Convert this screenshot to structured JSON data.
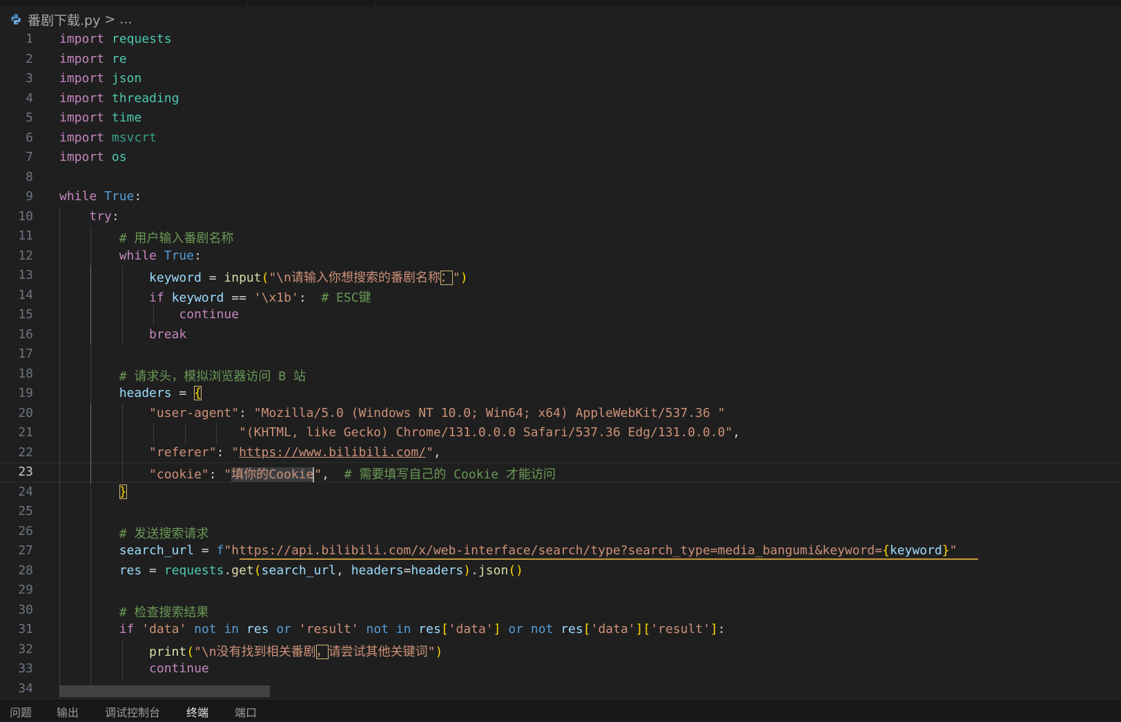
{
  "breadcrumb": {
    "file": "番剧下载.py",
    "separator": ">",
    "more": "..."
  },
  "editor": {
    "current_line": 23,
    "lines": [
      {
        "n": "1",
        "t": [
          [
            "import",
            "kw"
          ],
          [
            " ",
            ""
          ],
          [
            "requests",
            "md"
          ]
        ]
      },
      {
        "n": "2",
        "t": [
          [
            "import",
            "kw"
          ],
          [
            " ",
            ""
          ],
          [
            "re",
            "md"
          ]
        ]
      },
      {
        "n": "3",
        "t": [
          [
            "import",
            "kw"
          ],
          [
            " ",
            ""
          ],
          [
            "json",
            "md"
          ]
        ]
      },
      {
        "n": "4",
        "t": [
          [
            "import",
            "kw"
          ],
          [
            " ",
            ""
          ],
          [
            "threading",
            "md"
          ]
        ]
      },
      {
        "n": "5",
        "t": [
          [
            "import",
            "kw"
          ],
          [
            " ",
            ""
          ],
          [
            "time",
            "md"
          ]
        ]
      },
      {
        "n": "6",
        "t": [
          [
            "import",
            "kw"
          ],
          [
            " ",
            ""
          ],
          [
            "msvcrt",
            "md-dim"
          ]
        ]
      },
      {
        "n": "7",
        "t": [
          [
            "import",
            "kw"
          ],
          [
            " ",
            ""
          ],
          [
            "os",
            "md"
          ]
        ]
      },
      {
        "n": "8",
        "t": []
      },
      {
        "n": "9",
        "t": [
          [
            "while",
            "kw"
          ],
          [
            " ",
            ""
          ],
          [
            "True",
            "bi"
          ],
          [
            ":",
            "op"
          ]
        ]
      },
      {
        "n": "10",
        "t": [
          [
            "    ",
            ""
          ],
          [
            "try",
            "kw"
          ],
          [
            ":",
            "op"
          ]
        ]
      },
      {
        "n": "11",
        "t": [
          [
            "        ",
            ""
          ],
          [
            "# 用户输入番剧名称",
            "com"
          ]
        ]
      },
      {
        "n": "12",
        "t": [
          [
            "        ",
            ""
          ],
          [
            "while",
            "kw"
          ],
          [
            " ",
            ""
          ],
          [
            "True",
            "bi"
          ],
          [
            ":",
            "op"
          ]
        ]
      },
      {
        "n": "13",
        "t": [
          [
            "            ",
            ""
          ],
          [
            "keyword",
            "var"
          ],
          [
            " = ",
            "op"
          ],
          [
            "input",
            "fn"
          ],
          [
            "(",
            "yb"
          ],
          [
            "\"\\n请输入你想搜索的番剧名称",
            "str"
          ],
          [
            "：",
            "str box"
          ],
          [
            "\"",
            "str"
          ],
          [
            ")",
            "yb"
          ]
        ]
      },
      {
        "n": "14",
        "t": [
          [
            "            ",
            ""
          ],
          [
            "if",
            "kw"
          ],
          [
            " ",
            ""
          ],
          [
            "keyword",
            "var"
          ],
          [
            " == ",
            "op"
          ],
          [
            "'\\x1b'",
            "str"
          ],
          [
            ":  ",
            "op"
          ],
          [
            "# ESC键",
            "com"
          ]
        ]
      },
      {
        "n": "15",
        "t": [
          [
            "                ",
            ""
          ],
          [
            "continue",
            "kw"
          ]
        ]
      },
      {
        "n": "16",
        "t": [
          [
            "            ",
            ""
          ],
          [
            "break",
            "kw"
          ]
        ]
      },
      {
        "n": "17",
        "t": []
      },
      {
        "n": "18",
        "t": [
          [
            "        ",
            ""
          ],
          [
            "# 请求头，模拟浏览器访问 B 站",
            "com"
          ]
        ]
      },
      {
        "n": "19",
        "t": [
          [
            "        ",
            ""
          ],
          [
            "headers",
            "var"
          ],
          [
            " = ",
            "op"
          ],
          [
            "{",
            "yb box"
          ]
        ]
      },
      {
        "n": "20",
        "t": [
          [
            "            ",
            ""
          ],
          [
            "\"user-agent\"",
            "str"
          ],
          [
            ": ",
            "op"
          ],
          [
            "\"Mozilla/5.0 (Windows NT 10.0; Win64; x64) AppleWebKit/537.36 \"",
            "str"
          ]
        ]
      },
      {
        "n": "21",
        "t": [
          [
            "                        ",
            ""
          ],
          [
            "\"(KHTML, like Gecko) Chrome/131.0.0.0 Safari/537.36 Edg/131.0.0.0\"",
            "str"
          ],
          [
            ",",
            "op"
          ]
        ]
      },
      {
        "n": "22",
        "t": [
          [
            "            ",
            ""
          ],
          [
            "\"referer\"",
            "str"
          ],
          [
            ": ",
            "op"
          ],
          [
            "\"",
            "str"
          ],
          [
            "https://www.bilibili.com/",
            "str link"
          ],
          [
            "\"",
            "str"
          ],
          [
            ",",
            "op"
          ]
        ]
      },
      {
        "n": "23",
        "t": [
          [
            "            ",
            ""
          ],
          [
            "\"cookie\"",
            "str"
          ],
          [
            ": ",
            "op"
          ],
          [
            "\"",
            "str"
          ],
          [
            "填你的Cookie",
            "str sel"
          ],
          [
            "",
            "caret"
          ],
          [
            "\"",
            "str"
          ],
          [
            ",  ",
            "op"
          ],
          [
            "# 需要填写自己的 Cookie 才能访问",
            "com"
          ]
        ]
      },
      {
        "n": "24",
        "t": [
          [
            "        ",
            ""
          ],
          [
            "}",
            "yb box"
          ]
        ]
      },
      {
        "n": "25",
        "t": []
      },
      {
        "n": "26",
        "t": [
          [
            "        ",
            ""
          ],
          [
            "# 发送搜索请求",
            "com"
          ]
        ]
      },
      {
        "n": "27",
        "t": [
          [
            "        ",
            ""
          ],
          [
            "search_url",
            "var"
          ],
          [
            " = ",
            "op"
          ],
          [
            "f",
            "bi"
          ],
          [
            "\"",
            "str"
          ],
          [
            "https://api.bilibili.com/x/web-interface/search/type?search_type=media_bangumi&keyword=",
            "str"
          ],
          [
            "{",
            "yb"
          ],
          [
            "keyword",
            "var"
          ],
          [
            "}",
            "yb"
          ],
          [
            "\"",
            "str"
          ]
        ]
      },
      {
        "n": "28",
        "t": [
          [
            "        ",
            ""
          ],
          [
            "res",
            "var"
          ],
          [
            " = ",
            "op"
          ],
          [
            "requests",
            "md"
          ],
          [
            ".",
            "op"
          ],
          [
            "get",
            "fn"
          ],
          [
            "(",
            "yb"
          ],
          [
            "search_url",
            "var"
          ],
          [
            ", ",
            "op"
          ],
          [
            "headers",
            "var"
          ],
          [
            "=",
            "op"
          ],
          [
            "headers",
            "var"
          ],
          [
            ")",
            "yb"
          ],
          [
            ".",
            "op"
          ],
          [
            "json",
            "fn"
          ],
          [
            "()",
            "yb"
          ]
        ]
      },
      {
        "n": "29",
        "t": []
      },
      {
        "n": "30",
        "t": [
          [
            "        ",
            ""
          ],
          [
            "# 检查搜索结果",
            "com"
          ]
        ]
      },
      {
        "n": "31",
        "t": [
          [
            "        ",
            ""
          ],
          [
            "if",
            "kw"
          ],
          [
            " ",
            ""
          ],
          [
            "'data'",
            "str"
          ],
          [
            " ",
            ""
          ],
          [
            "not in",
            "bi"
          ],
          [
            " ",
            ""
          ],
          [
            "res",
            "var"
          ],
          [
            " ",
            ""
          ],
          [
            "or",
            "bi"
          ],
          [
            " ",
            ""
          ],
          [
            "'result'",
            "str"
          ],
          [
            " ",
            ""
          ],
          [
            "not in",
            "bi"
          ],
          [
            " ",
            ""
          ],
          [
            "res",
            "var"
          ],
          [
            "[",
            "yb"
          ],
          [
            "'data'",
            "str"
          ],
          [
            "]",
            "yb"
          ],
          [
            " ",
            ""
          ],
          [
            "or",
            "bi"
          ],
          [
            " ",
            ""
          ],
          [
            "not",
            "bi"
          ],
          [
            " ",
            ""
          ],
          [
            "res",
            "var"
          ],
          [
            "[",
            "yb"
          ],
          [
            "'data'",
            "str"
          ],
          [
            "][",
            "yb"
          ],
          [
            "'result'",
            "str"
          ],
          [
            "]",
            "yb"
          ],
          [
            ":",
            "op"
          ]
        ]
      },
      {
        "n": "32",
        "t": [
          [
            "            ",
            ""
          ],
          [
            "print",
            "fn"
          ],
          [
            "(",
            "yb"
          ],
          [
            "\"\\n没有找到相关番剧",
            "str"
          ],
          [
            "，",
            "str box"
          ],
          [
            "请尝试其他关键词\"",
            "str"
          ],
          [
            ")",
            "yb"
          ]
        ]
      },
      {
        "n": "33",
        "t": [
          [
            "            ",
            ""
          ],
          [
            "continue",
            "kw"
          ]
        ]
      },
      {
        "n": "34",
        "t": []
      }
    ]
  },
  "panel": {
    "tabs": [
      "问题",
      "输出",
      "调试控制台",
      "终端",
      "端口"
    ],
    "active_index": 3
  }
}
